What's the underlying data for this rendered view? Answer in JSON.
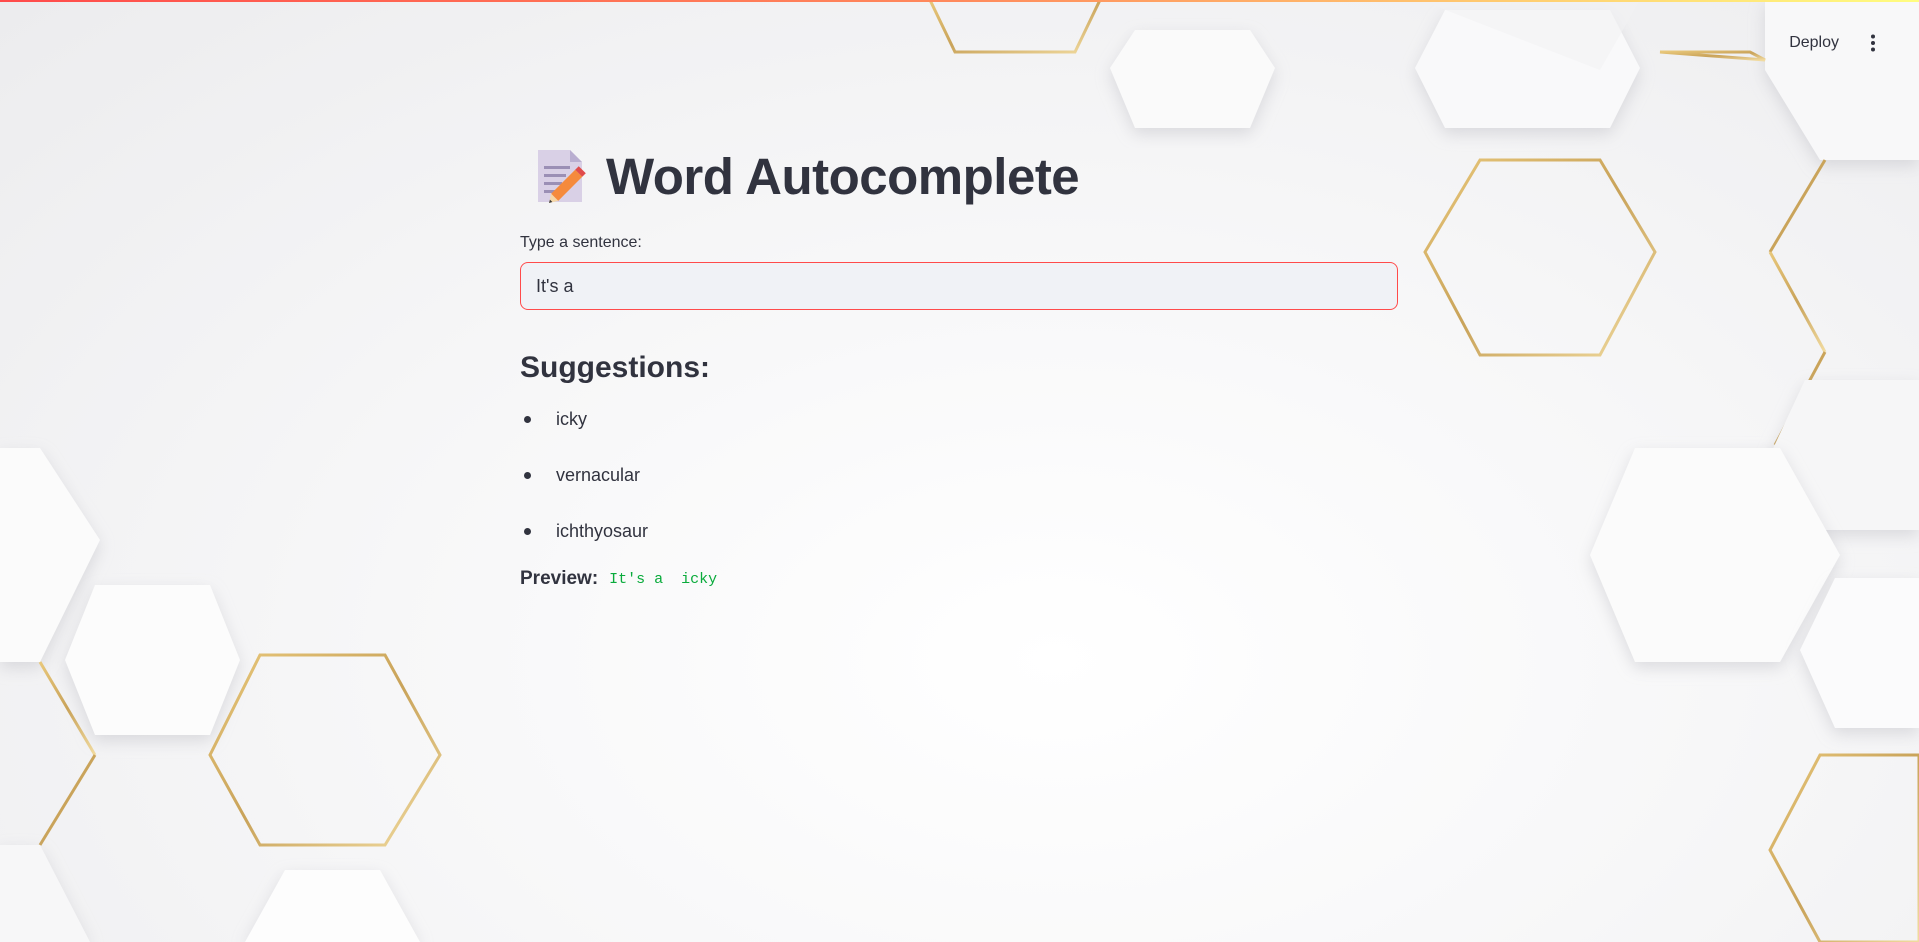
{
  "header": {
    "deploy_label": "Deploy",
    "menu_icon": "vertical-dots-icon"
  },
  "page": {
    "title_icon": "memo-emoji-icon",
    "title": "Word Autocomplete",
    "input_label": "Type a sentence:",
    "input_value": "It's a",
    "suggestions_heading": "Suggestions:",
    "suggestions": [
      "icky",
      "vernacular",
      "ichthyosaur"
    ],
    "preview_label": "Preview:",
    "preview_value": "It's a  icky"
  },
  "colors": {
    "accent": "#ff4b4b",
    "text": "#31333f",
    "code_green": "#09ab3b",
    "input_bg": "#f0f2f6"
  }
}
